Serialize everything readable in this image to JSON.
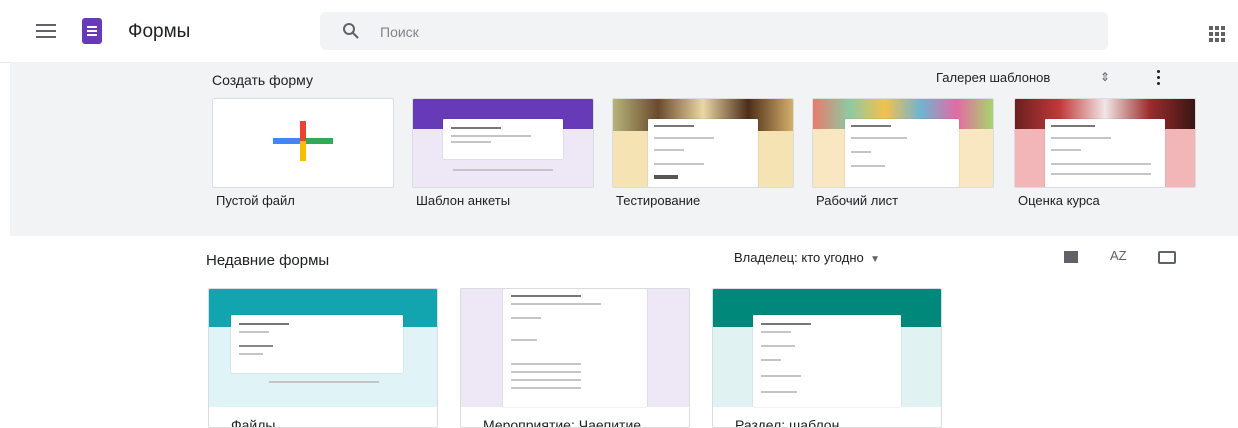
{
  "header": {
    "app_title": "Формы",
    "search_placeholder": "Поиск",
    "logo_color": "#673ab7"
  },
  "templates": {
    "section_title": "Создать форму",
    "gallery_label": "Галерея шаблонов",
    "items": [
      {
        "label": "Пустой файл"
      },
      {
        "label": "Шаблон анкеты",
        "accent": "#673ab7"
      },
      {
        "label": "Тестирование",
        "accent": "#f6e3b4"
      },
      {
        "label": "Рабочий лист",
        "accent": "#f8e7c0"
      },
      {
        "label": "Оценка курса",
        "accent": "#f3b6b8"
      }
    ]
  },
  "recent": {
    "section_title": "Недавние формы",
    "owner_filter": "Владелец: кто угодно",
    "sort_label": "AZ",
    "items": [
      {
        "name": "Файлы",
        "accent": "#12a4af"
      },
      {
        "name": "Мероприятие: Чаепитие",
        "accent": "#ede7f6"
      },
      {
        "name": "Раздел: шаблон",
        "accent": "#00897b"
      }
    ]
  }
}
